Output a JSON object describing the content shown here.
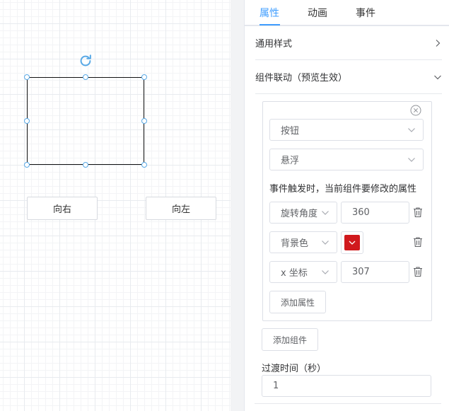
{
  "canvas": {
    "buttons": [
      "向右",
      "向左"
    ]
  },
  "panel": {
    "tabs": [
      "属性",
      "动画",
      "事件"
    ],
    "active_tab": "属性",
    "sections": {
      "common_style": "通用样式",
      "linkage": "组件联动（预览生效）"
    },
    "linkage": {
      "component_select": "按钮",
      "event_select": "悬浮",
      "hint": "事件触发时，当前组件要修改的属性",
      "properties": [
        {
          "name": "旋转角度",
          "value": "360"
        },
        {
          "name": "背景色",
          "value": "#d0191d"
        },
        {
          "name": "x 坐标",
          "value": "307"
        }
      ],
      "add_property": "添加属性"
    },
    "add_component": "添加组件",
    "transition_label": "过渡时间（秒）",
    "transition_value": "1"
  },
  "colors": {
    "accent": "#409eff",
    "handle": "#59a9e6",
    "swatch": "#d0191d"
  }
}
